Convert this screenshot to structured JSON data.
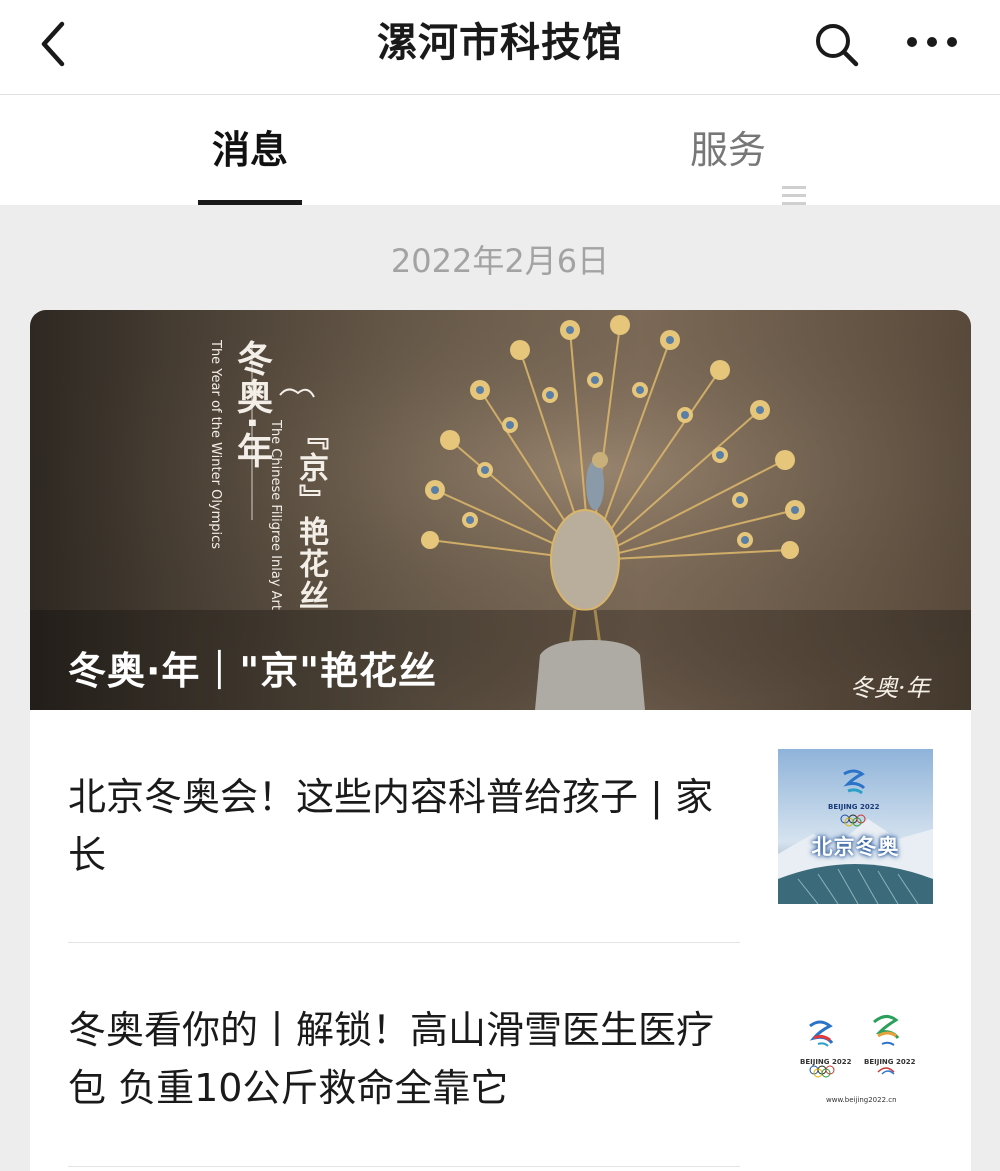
{
  "header": {
    "title": "漯河市科技馆",
    "back_icon": "chevron-left-icon",
    "search_icon": "search-icon",
    "more_icon": "more-dots-icon"
  },
  "tabs": {
    "messages": "消息",
    "services": "服务",
    "services_icon": "menu-lines-icon"
  },
  "feed": {
    "date": "2022年2月6日",
    "cover": {
      "headline": "冬奥·年｜\"京\"艳花丝",
      "side_title": "冬奥·年",
      "side_title_en": "The Year of the Winter Olympics",
      "side_sub": "『京』艳花丝",
      "side_sub_en": "The Chinese Filigree Inlay Art",
      "signature": "冬奥·年"
    },
    "articles": [
      {
        "title": "北京冬奥会！这些内容科普给孩子 | 家长",
        "thumb_text": "北京冬奥",
        "thumb_logo_text": "BEIJING 2022"
      },
      {
        "title": "冬奥看你的丨解锁！高山滑雪医生医疗包 负重10公斤救命全靠它",
        "thumb_logo_left": "BEIJING 2022",
        "thumb_logo_right": "BEIJING 2022",
        "thumb_url": "www.beijing2022.cn"
      }
    ]
  },
  "colors": {
    "background": "#ededed",
    "accent_text": "#111111",
    "muted_text": "#a3a3a3"
  }
}
